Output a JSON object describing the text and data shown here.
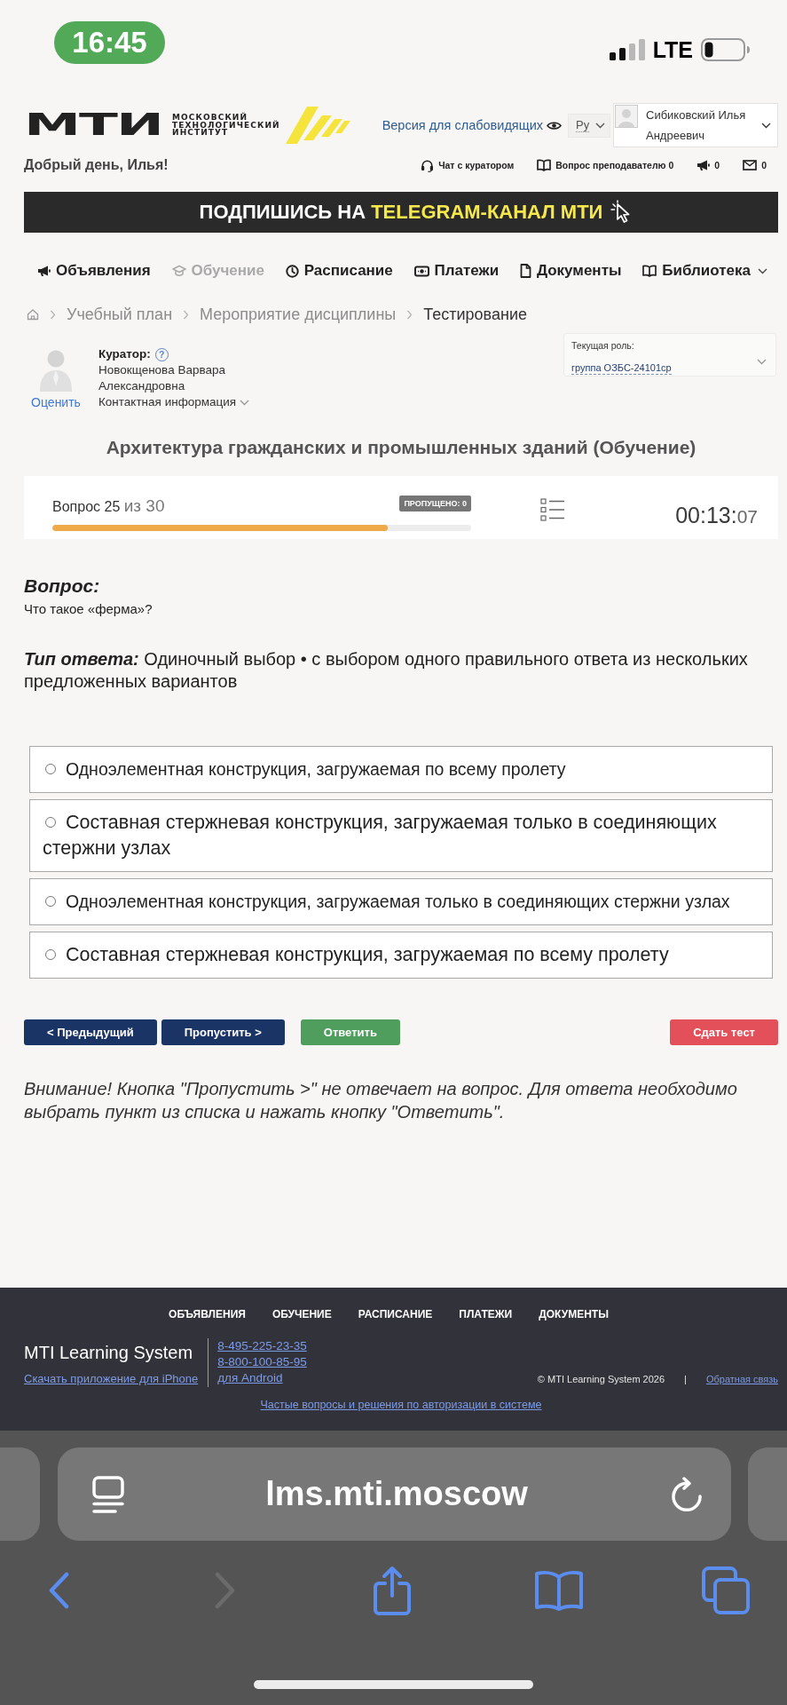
{
  "status_bar": {
    "time": "16:45",
    "network": "LTE"
  },
  "header": {
    "logo": {
      "wordmark": "МТИ",
      "caption": "МОСКОВСКИЙ ТЕХНОЛОГИЧЕСКИЙ ИНСТИТУТ"
    },
    "accessibility_link": "Версия для слабовидящих",
    "language": "Ру",
    "user_name": "Сибиковский Илья Андреевич",
    "greeting": "Добрый день, Илья!",
    "actions": [
      {
        "kind": "chat",
        "label": "Чат с куратором"
      },
      {
        "kind": "question",
        "label": "Вопрос преподавателю",
        "count": "0"
      },
      {
        "kind": "news",
        "count": "0"
      },
      {
        "kind": "mail",
        "count": "0"
      }
    ]
  },
  "banner": {
    "text": "ПОДПИШИСЬ НА",
    "highlight": "TELEGRAM-КАНАЛ МТИ"
  },
  "nav": [
    {
      "kind": "announcements",
      "label": "Объявления",
      "selected": false,
      "dropdown": false
    },
    {
      "kind": "study",
      "label": "Обучение",
      "selected": true,
      "dropdown": false
    },
    {
      "kind": "schedule",
      "label": "Расписание",
      "selected": false,
      "dropdown": false
    },
    {
      "kind": "payments",
      "label": "Платежи",
      "selected": false,
      "dropdown": false
    },
    {
      "kind": "documents",
      "label": "Документы",
      "selected": false,
      "dropdown": false
    },
    {
      "kind": "library",
      "label": "Библиотека",
      "selected": false,
      "dropdown": true
    }
  ],
  "breadcrumbs": [
    {
      "label": "Учебный план",
      "current": false
    },
    {
      "label": "Мероприятие дисциплины",
      "current": false
    },
    {
      "label": "Тестирование",
      "current": true
    }
  ],
  "curator": {
    "label": "Куратор:",
    "help": "?",
    "name": "Новокщенова Варвара Александровна",
    "rate_link": "Оценить",
    "contacts_link": "Контактная информация"
  },
  "role": {
    "label": "Текущая роль:",
    "value": "группа ОЗБС-24101ср"
  },
  "test": {
    "title": "Архитектура гражданских и промышленных зданий (Обучение)",
    "question_number": "Вопрос 25",
    "question_total": "из 30",
    "skipped": "ПРОПУЩЕНО: 0",
    "level": 0.8,
    "timer": "00:13:",
    "timer_seconds": "07"
  },
  "question": {
    "heading": "Вопрос:",
    "text": "Что такое «ферма»?",
    "answer_type_label": "Тип ответа:",
    "answer_type": "Одиночный выбор • с выбором одного правильного ответа из нескольких предложенных вариантов",
    "options": [
      {
        "text": "Одноэлементная конструкция, загружаемая по всему пролету",
        "selected": false
      },
      {
        "text": "Составная стержневая конструкция, загружаемая только в соединяющих стержни узлах",
        "selected": false
      },
      {
        "text": "Одноэлементная конструкция, загружаемая только в соединяющих стержни узлах",
        "selected": false
      },
      {
        "text": "Составная стержневая конструкция, загружаемая по всему пролету",
        "selected": false
      }
    ]
  },
  "buttons": [
    {
      "kind": "previous",
      "label": "< Предыдущий"
    },
    {
      "kind": "skip",
      "label": "Пропустить >"
    },
    {
      "kind": "answer",
      "label": "Ответить"
    },
    {
      "kind": "submit",
      "label": "Сдать тест"
    }
  ],
  "note": "Внимание! Кнопка \"Пропустить >\" не отвечает на вопрос. Для ответа необходимо выбрать пункт из списка и нажать кнопку \"Ответить\".",
  "footer": {
    "nav": [
      "ОБЪЯВЛЕНИЯ",
      "ОБУЧЕНИЕ",
      "РАСПИСАНИЕ",
      "ПЛАТЕЖИ",
      "ДОКУМЕНТЫ"
    ],
    "brand": "MTI Learning System",
    "iphone_link": "Скачать приложение для iPhone",
    "phones": [
      "8-495-225-23-35",
      "8-800-100-85-95"
    ],
    "android_link": "для Android",
    "copyright": "© MTI Learning System 2026",
    "separator": "|",
    "feedback_link": "Обратная связь",
    "faq_link": "Частые вопросы и решения по авторизации в системе"
  },
  "browser": {
    "url": "lms.mti.moscow"
  }
}
